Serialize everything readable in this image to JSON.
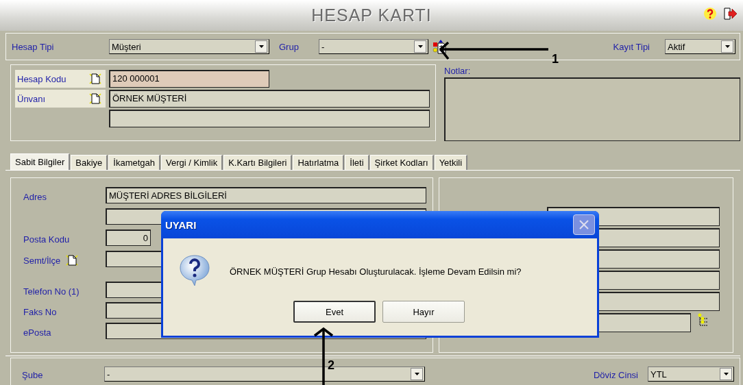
{
  "header": {
    "title": "HESAP KARTI"
  },
  "toolbar": {
    "fields": [
      {
        "label": "Hesap Tipi",
        "value": "Müşteri"
      },
      {
        "label": "Grup",
        "value": "-"
      }
    ],
    "record_type": {
      "label": "Kayıt Tipi",
      "value": "Aktif"
    }
  },
  "account_fields": [
    {
      "kind": "labeled",
      "label": "Hesap Kodu",
      "value": "120 000001",
      "highlighted": true
    },
    {
      "kind": "labeled",
      "label": "Ünvanı",
      "value": "ÖRNEK MÜŞTERİ",
      "highlighted": false
    },
    {
      "kind": "plain"
    }
  ],
  "notes": {
    "label": "Notlar:"
  },
  "tabs": [
    {
      "label": "Sabit Bilgiler",
      "selected": true
    },
    {
      "label": "Bakiye",
      "selected": false
    },
    {
      "label": "İkametgah",
      "selected": false
    },
    {
      "label": "Vergi / Kimlik",
      "selected": false
    },
    {
      "label": "K.Kartı Bilgileri",
      "selected": false
    },
    {
      "label": "Hatırlatma",
      "selected": false
    },
    {
      "label": "İleti",
      "selected": false
    },
    {
      "label": "Şirket Kodları",
      "selected": false
    },
    {
      "label": "Yetkili",
      "selected": false
    }
  ],
  "address_fields": [
    {
      "kind": "text",
      "label": "Adres",
      "value": "MÜŞTERİ ADRES BİLGİLERİ"
    },
    {
      "kind": "plain"
    },
    {
      "kind": "short",
      "label": "Posta Kodu",
      "value": "0"
    },
    {
      "kind": "lookup",
      "label": "Semt/İlçe"
    }
  ],
  "contact_fields": [
    {
      "kind": "text",
      "label": "Telefon No (1)"
    },
    {
      "kind": "text",
      "label": "Faks No"
    },
    {
      "kind": "text",
      "label": "ePosta"
    }
  ],
  "side_fields": [
    {
      "kind": "plain"
    },
    {
      "kind": "plain"
    },
    {
      "kind": "plain"
    },
    {
      "kind": "plain"
    },
    {
      "kind": "plain"
    },
    {
      "kind": "tree"
    }
  ],
  "bottom": {
    "branch": {
      "label": "Şube",
      "value": "-"
    },
    "currency": {
      "label": "Döviz Cinsi",
      "value": "YTL"
    }
  },
  "dialog": {
    "title": "UYARI",
    "message": "ÖRNEK MÜŞTERİ Grup Hesabı Oluşturulacak. İşleme Devam Edilsin mi?",
    "buttons": [
      {
        "label": "Evet",
        "focused": true
      },
      {
        "label": "Hayır",
        "focused": false
      }
    ]
  },
  "annotations": [
    {
      "label": "1"
    },
    {
      "label": "2"
    }
  ]
}
